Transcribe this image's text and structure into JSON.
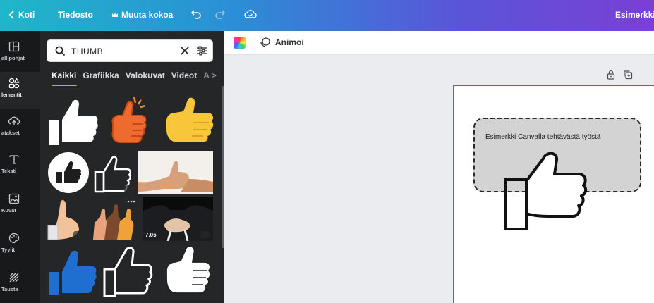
{
  "topbar": {
    "home": "Koti",
    "file": "Tiedosto",
    "resize": "Muuta kokoa",
    "title": "Esimerkki"
  },
  "rail": {
    "items": [
      {
        "label": "allipohjat",
        "icon": "templates-icon"
      },
      {
        "label": "lementit",
        "icon": "elements-icon"
      },
      {
        "label": "atakset",
        "icon": "uploads-icon"
      },
      {
        "label": "Teksti",
        "icon": "text-icon"
      },
      {
        "label": "Kuvat",
        "icon": "photos-icon"
      },
      {
        "label": "Tyylit",
        "icon": "styles-icon"
      },
      {
        "label": "Tausta",
        "icon": "background-icon"
      }
    ]
  },
  "search": {
    "value": "THUMB",
    "placeholder": ""
  },
  "tabs": {
    "items": [
      "Kaikki",
      "Grafiikka",
      "Valokuvat",
      "Videot"
    ],
    "active": "Kaikki",
    "more_symbol": "A >"
  },
  "grid": {
    "video_duration": "7.0s"
  },
  "toolbar": {
    "animate": "Animoi"
  },
  "canvas": {
    "textbox_text": "Esimerkki Canvalla tehtävästä työstä"
  },
  "colors": {
    "accent": "#8b3dff",
    "thumb_blue": "#1f6fd1",
    "thumb_orange": "#ef6a2e",
    "thumb_yellow": "#f7c63a"
  }
}
